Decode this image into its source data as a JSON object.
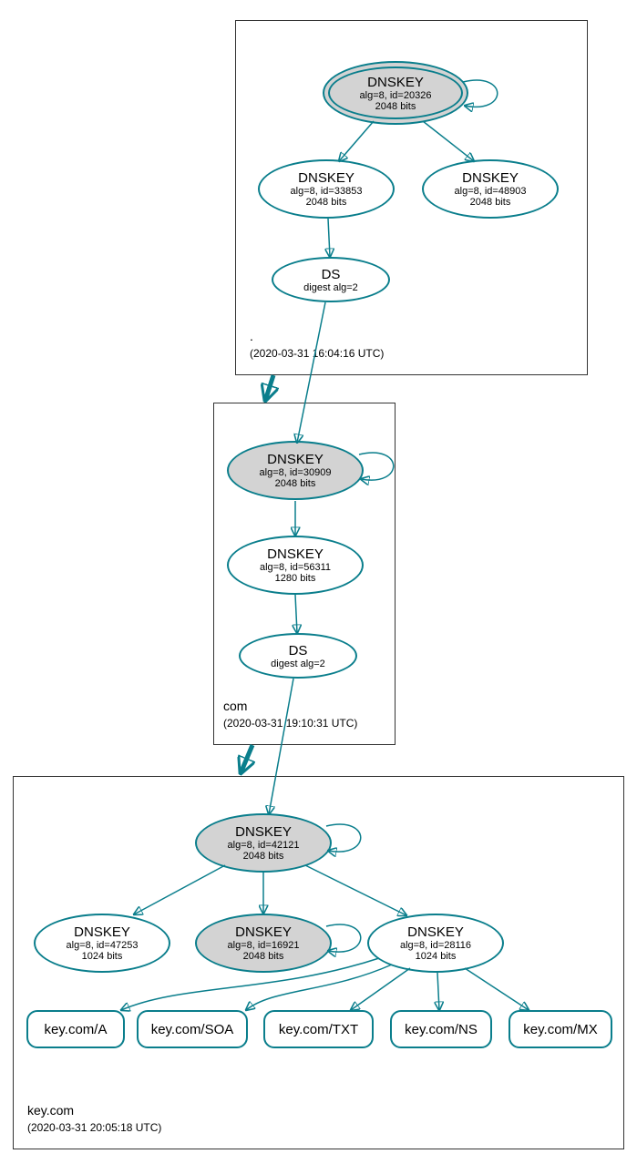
{
  "zones": {
    "root": {
      "name": ".",
      "timestamp": "(2020-03-31 16:04:16 UTC)"
    },
    "com": {
      "name": "com",
      "timestamp": "(2020-03-31 19:10:31 UTC)"
    },
    "key": {
      "name": "key.com",
      "timestamp": "(2020-03-31 20:05:18 UTC)"
    }
  },
  "nodes": {
    "root_ksk": {
      "title": "DNSKEY",
      "line2": "alg=8, id=20326",
      "line3": "2048 bits"
    },
    "root_zsk": {
      "title": "DNSKEY",
      "line2": "alg=8, id=33853",
      "line3": "2048 bits"
    },
    "root_ext": {
      "title": "DNSKEY",
      "line2": "alg=8, id=48903",
      "line3": "2048 bits"
    },
    "root_ds": {
      "title": "DS",
      "line2": "digest alg=2"
    },
    "com_ksk": {
      "title": "DNSKEY",
      "line2": "alg=8, id=30909",
      "line3": "2048 bits"
    },
    "com_zsk": {
      "title": "DNSKEY",
      "line2": "alg=8, id=56311",
      "line3": "1280 bits"
    },
    "com_ds": {
      "title": "DS",
      "line2": "digest alg=2"
    },
    "key_ksk": {
      "title": "DNSKEY",
      "line2": "alg=8, id=42121",
      "line3": "2048 bits"
    },
    "key_z1": {
      "title": "DNSKEY",
      "line2": "alg=8, id=47253",
      "line3": "1024 bits"
    },
    "key_z2": {
      "title": "DNSKEY",
      "line2": "alg=8, id=16921",
      "line3": "2048 bits"
    },
    "key_z3": {
      "title": "DNSKEY",
      "line2": "alg=8, id=28116",
      "line3": "1024 bits"
    }
  },
  "rr": {
    "a": "key.com/A",
    "soa": "key.com/SOA",
    "txt": "key.com/TXT",
    "ns": "key.com/NS",
    "mx": "key.com/MX"
  }
}
